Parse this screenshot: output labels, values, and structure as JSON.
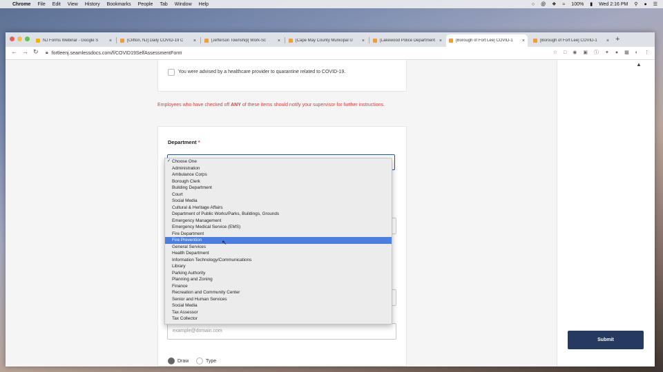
{
  "menubar": {
    "apple": "",
    "app": "Chrome",
    "items": [
      "File",
      "Edit",
      "View",
      "History",
      "Bookmarks",
      "People",
      "Tab",
      "Window",
      "Help"
    ],
    "battery": "100%",
    "clock": "Wed 2:16 PM"
  },
  "tabs": [
    {
      "label": "NJ Forms Webinar - Google S",
      "color": "#f4b400"
    },
    {
      "label": "[Clifton, NJ] Daily COVID-19 C",
      "color": "#f29c38"
    },
    {
      "label": "[Jefferson Township] Work-Sc",
      "color": "#f29c38"
    },
    {
      "label": "[Cape May County Municipal U",
      "color": "#f29c38"
    },
    {
      "label": "[Lakewood Police Department",
      "color": "#f29c38"
    },
    {
      "label": "[Borough of Fort Lee] COVID-1",
      "color": "#f29c38"
    },
    {
      "label": "[Borough of Fort Lee] COVID-1",
      "color": "#f29c38"
    }
  ],
  "url": "fortleenj.seamlessdocs.com/f/COVID19SelfAssessmentForm",
  "form": {
    "quarantine_label": "You were advised by a healthcare provider to quarantine related to COVID-19.",
    "notice_pre": "Employees who have checked off ",
    "notice_bold": "ANY",
    "notice_post": " of these items should notify your supervisor for further instructions.",
    "department_label": "Department",
    "required_mark": "*",
    "email_placeholder": "example@domain.com",
    "draw_label": "Draw",
    "type_label": "Type"
  },
  "dropdown": {
    "selected_index": 0,
    "highlighted_index": 12,
    "options": [
      "Choose One",
      "Administration",
      "Ambulance Corps",
      "Borough Clerk",
      "Building Department",
      "Court",
      "Social Media",
      "Cultural & Heritage Affairs",
      "Department of Public Works/Parks, Buildings, Grounds",
      "Emergency Management",
      "Emergency Medical Service (EMS)",
      "Fire Department",
      "Fire Prevention",
      "General Services",
      "Health Department",
      "Information Technology/Communications",
      "Library",
      "Parking Authority",
      "Planning and Zoning",
      "Finance",
      "Recreation and Community Center",
      "Senior and Human Services",
      "Social Media",
      "Tax Assessor",
      "Tax Collector"
    ]
  },
  "submit_label": "Submit",
  "colors": {
    "accent": "#253a5e",
    "warning": "#d43d3d",
    "highlight": "#4b7ee0",
    "focus": "#2b4fa8"
  }
}
